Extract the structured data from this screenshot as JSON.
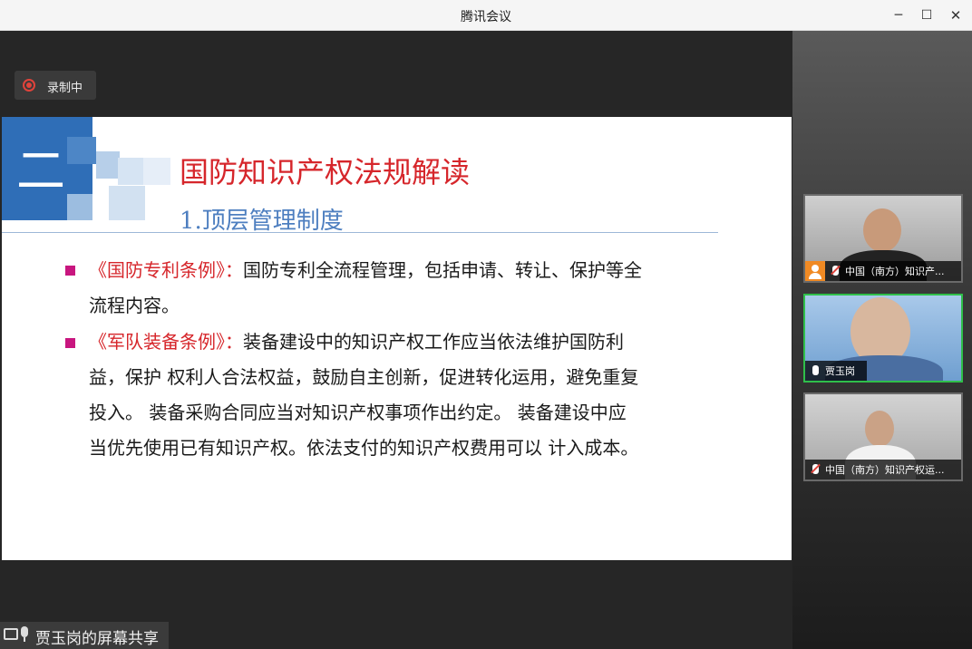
{
  "window": {
    "title": "腾讯会议",
    "min_glyph": "─",
    "max_glyph": "☐",
    "close_glyph": "✕"
  },
  "recording": {
    "label": "录制中",
    "icon": "record-icon"
  },
  "slide": {
    "big_char": "二",
    "title": "国防知识产权法规解读",
    "subtitle": "1.顶层管理制度",
    "items": [
      {
        "highlight": "《国防专利条例》：",
        "text": "国防专利全流程管理，包括申请、转让、保护等全流程内容。"
      },
      {
        "highlight": "《军队装备条例》：",
        "text": "装备建设中的知识产权工作应当依法维护国防利益，保护 权利人合法权益，鼓励自主创新，促进转化运用，避免重复投入。 装备采购合同应当对知识产权事项作出约定。 装备建设中应当优先使用已有知识产权。依法支付的知识产权费用可以 计入成本。"
      }
    ],
    "colors": {
      "title": "#d6262b",
      "subtitle": "#4e7fc0",
      "bullet": "#c8167f",
      "deco": "#2f6eb7"
    }
  },
  "share_bar": {
    "label": "贾玉岗的屏幕共享",
    "icons": [
      "screen-share-icon",
      "mic-icon"
    ]
  },
  "participants": [
    {
      "name": "中国（南方）知识产...",
      "muted": true,
      "has_avatar_badge": true,
      "active_speaker": false
    },
    {
      "name": "贾玉岗",
      "muted": false,
      "has_avatar_badge": false,
      "active_speaker": true
    },
    {
      "name": "中国（南方）知识产权运...",
      "muted": true,
      "has_avatar_badge": false,
      "active_speaker": false
    }
  ]
}
